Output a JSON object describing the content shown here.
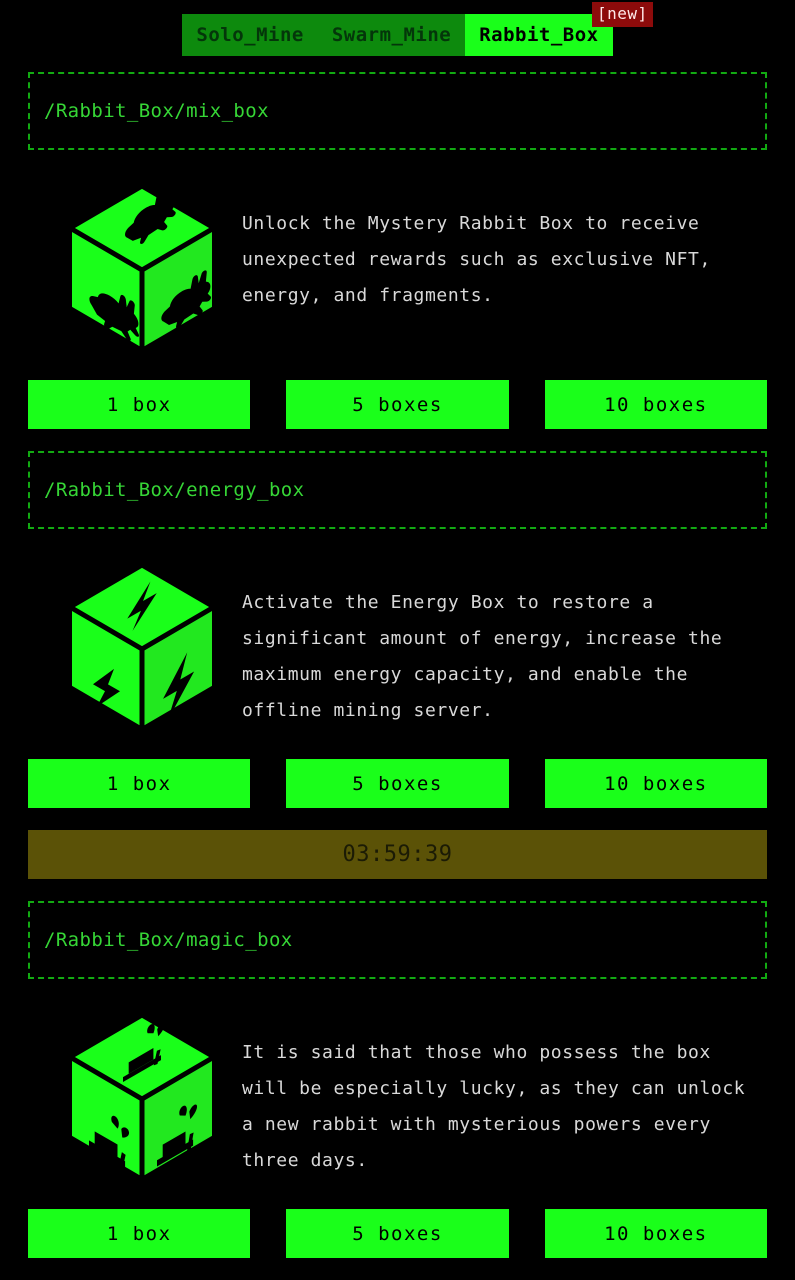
{
  "theme": {
    "background": "#000000",
    "accent_green": "#1aff1a",
    "dim_green": "#0d8a0d",
    "path_green": "#36d636",
    "badge_red": "#8d0b0b",
    "timer_olive": "#5b5207",
    "text_gray": "#d9d9d9"
  },
  "tabs": [
    {
      "label": "Solo_Mine",
      "active": false,
      "badge": null
    },
    {
      "label": "Swarm_Mine",
      "active": false,
      "badge": null
    },
    {
      "label": "Rabbit_Box",
      "active": true,
      "badge": "[new]"
    }
  ],
  "sections": [
    {
      "path": "/Rabbit_Box/mix_box",
      "icon": "rabbit-cube-icon",
      "description": "Unlock the Mystery Rabbit Box to receive unexpected rewards such as exclusive NFT, energy, and fragments.",
      "buttons": [
        {
          "label": "1 box"
        },
        {
          "label": "5 boxes"
        },
        {
          "label": "10 boxes"
        }
      ],
      "timer": null
    },
    {
      "path": "/Rabbit_Box/energy_box",
      "icon": "lightning-cube-icon",
      "description": "Activate the Energy Box to restore a significant amount of energy, increase the maximum energy capacity, and enable the offline mining server.",
      "buttons": [
        {
          "label": "1 box"
        },
        {
          "label": "5 boxes"
        },
        {
          "label": "10 boxes"
        }
      ],
      "timer": "03:59:39"
    },
    {
      "path": "/Rabbit_Box/magic_box",
      "icon": "magic-hat-cube-icon",
      "description": "It is said that those who possess the box will be especially lucky, as they can unlock a new rabbit with mysterious powers every three days.",
      "buttons": [
        {
          "label": "1 box"
        },
        {
          "label": "5 boxes"
        },
        {
          "label": "10 boxes"
        }
      ],
      "timer": null
    }
  ]
}
